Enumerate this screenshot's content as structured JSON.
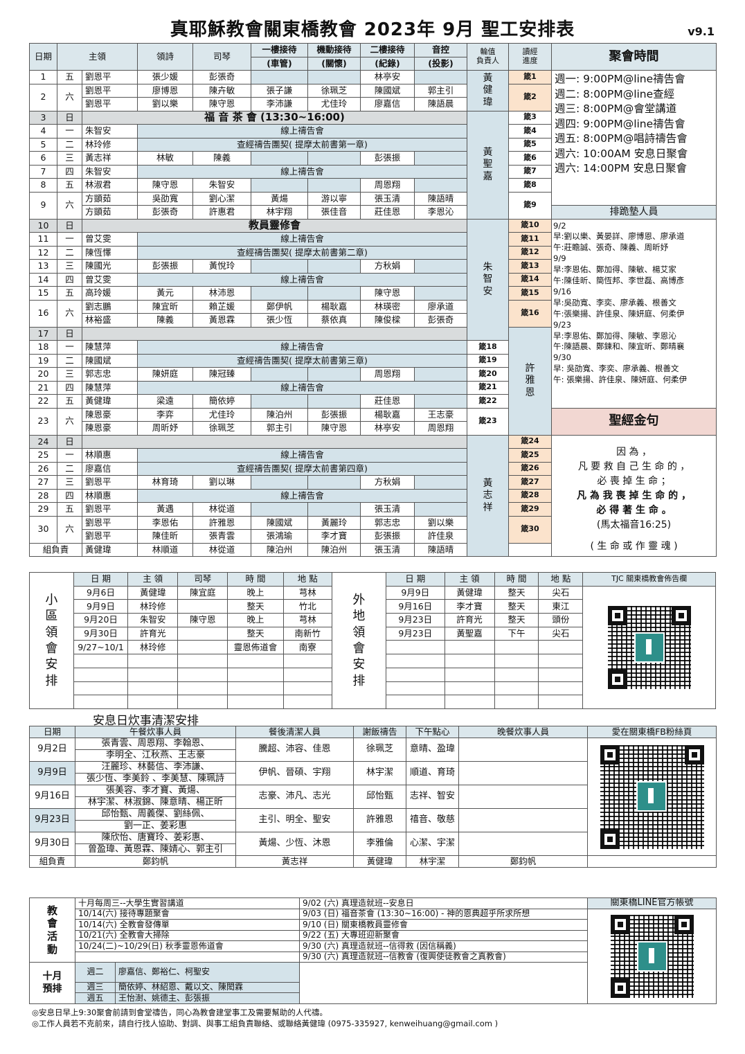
{
  "title": "真耶穌教會關東橋教會 2023年 9月 聖工安排表",
  "version": "v9.1",
  "schedule": {
    "headers": {
      "date": "日期",
      "leader": "主領",
      "hymn": "領詩",
      "piano": "司琴",
      "floor1_top": "一樓接待",
      "floor1_bottom": "(車管)",
      "mobile_top": "機動接待",
      "mobile_bottom": "(關懷)",
      "floor2_top": "二樓接待",
      "floor2_bottom": "(紀錄)",
      "sound_top": "音控",
      "sound_bottom": "(投影)",
      "duty_top": "輪值",
      "duty_bottom": "負責人",
      "reading_top": "讀經",
      "reading_bottom": "進度"
    },
    "rows": [
      [
        "1",
        "五",
        "劉恩平",
        "張少媛",
        "彭張奇",
        "",
        "",
        "林亭安",
        "",
        "箴1"
      ],
      [
        "2",
        "六",
        "劉恩平",
        "廖博恩",
        "陳卉敏",
        "張子謙",
        "徐珮芝",
        "陳國斌",
        "郭主引",
        "箴2"
      ],
      [
        "",
        "",
        "劉恩平",
        "劉以樂",
        "陳守恩",
        "李沛謙",
        "尤佳玲",
        "廖嘉信",
        "陳語晨",
        ""
      ],
      [
        "3",
        "日",
        "福 音 茶 會 (13:30~16:00)",
        "",
        "",
        "",
        "",
        "",
        "",
        "箴3"
      ],
      [
        "4",
        "一",
        "朱智安",
        "線上禱告會",
        "",
        "",
        "",
        "",
        "",
        "箴4"
      ],
      [
        "5",
        "二",
        "林玲修",
        "查經禱告團契( 提摩太前書第一章)",
        "",
        "",
        "",
        "",
        "",
        "箴5"
      ],
      [
        "6",
        "三",
        "黃志祥",
        "林敏",
        "陳義",
        "",
        "",
        "彭張振",
        "",
        "箴6"
      ],
      [
        "7",
        "四",
        "朱智安",
        "線上禱告會",
        "",
        "",
        "",
        "",
        "",
        "箴7"
      ],
      [
        "8",
        "五",
        "林淑君",
        "陳守恩",
        "朱智安",
        "",
        "",
        "周恩翔",
        "",
        "箴8"
      ],
      [
        "9",
        "六",
        "方顗茹",
        "吳劭寬",
        "劉心潔",
        "黃煬",
        "游以寧",
        "張玉清",
        "陳語晴",
        "箴9"
      ],
      [
        "",
        "",
        "方顗茹",
        "彭張奇",
        "許惠君",
        "林宇翔",
        "張佳音",
        "莊佳恩",
        "李恩沁",
        ""
      ],
      [
        "10",
        "日",
        "教員靈修會",
        "",
        "",
        "",
        "",
        "",
        "",
        "箴10"
      ],
      [
        "11",
        "一",
        "曾艾雯",
        "線上禱告會",
        "",
        "",
        "",
        "",
        "",
        "箴11"
      ],
      [
        "12",
        "二",
        "陳恆懌",
        "查經禱告團契( 提摩太前書第二章)",
        "",
        "",
        "",
        "",
        "",
        "箴12"
      ],
      [
        "13",
        "三",
        "陳國光",
        "彭張振",
        "黃悅玲",
        "",
        "",
        "方秋娟",
        "",
        "箴13"
      ],
      [
        "14",
        "四",
        "曾艾雯",
        "線上禱告會",
        "",
        "",
        "",
        "",
        "",
        "箴14"
      ],
      [
        "15",
        "五",
        "高玲媛",
        "黃元",
        "林沛恩",
        "",
        "",
        "陳守恩",
        "",
        "箴15"
      ],
      [
        "16",
        "六",
        "劉志鵬",
        "陳宜昕",
        "賴芷媛",
        "鄭伊帆",
        "楊耿嘉",
        "林瑛密",
        "廖承道",
        "箴16"
      ],
      [
        "",
        "",
        "林裕盛",
        "陳義",
        "黃恩霖",
        "張少恆",
        "蔡依真",
        "陳俊樑",
        "彭張奇",
        ""
      ],
      [
        "17",
        "日",
        "",
        "",
        "",
        "",
        "",
        "",
        "",
        "箴17"
      ],
      [
        "18",
        "一",
        "陳慧萍",
        "線上禱告會",
        "",
        "",
        "",
        "",
        "",
        "箴18"
      ],
      [
        "19",
        "二",
        "陳國斌",
        "查經禱告團契( 提摩太前書第三章)",
        "",
        "",
        "",
        "",
        "",
        "箴19"
      ],
      [
        "20",
        "三",
        "郭志忠",
        "陳妍庭",
        "陳冠臻",
        "",
        "",
        "周恩翔",
        "",
        "箴20"
      ],
      [
        "21",
        "四",
        "陳慧萍",
        "線上禱告會",
        "",
        "",
        "",
        "",
        "",
        "箴21"
      ],
      [
        "22",
        "五",
        "黃健瑋",
        "梁遠",
        "簡依婷",
        "",
        "",
        "莊佳恩",
        "",
        "箴22"
      ],
      [
        "23",
        "六",
        "陳恩豪",
        "李弈",
        "尤佳玲",
        "陳泊州",
        "彭張振",
        "楊耿嘉",
        "王志豪",
        "箴23"
      ],
      [
        "",
        "",
        "陳恩豪",
        "周昕妤",
        "徐珮芝",
        "郭主引",
        "陳守恩",
        "林亭安",
        "周恩翔",
        ""
      ],
      [
        "24",
        "日",
        "",
        "",
        "",
        "",
        "",
        "",
        "",
        "箴24"
      ],
      [
        "25",
        "一",
        "林順惠",
        "線上禱告會",
        "",
        "",
        "",
        "",
        "",
        "箴25"
      ],
      [
        "26",
        "二",
        "廖嘉信",
        "查經禱告團契( 提摩太前書第四章)",
        "",
        "",
        "",
        "",
        "",
        "箴26"
      ],
      [
        "27",
        "三",
        "劉恩平",
        "林育琦",
        "劉以琳",
        "",
        "",
        "方秋娟",
        "",
        "箴27"
      ],
      [
        "28",
        "四",
        "林順惠",
        "線上禱告會",
        "",
        "",
        "",
        "",
        "",
        "箴28"
      ],
      [
        "29",
        "五",
        "劉恩平",
        "黃遇",
        "林從道",
        "",
        "",
        "張玉清",
        "",
        "箴29"
      ],
      [
        "30",
        "六",
        "劉恩平",
        "李恩佑",
        "許雅恩",
        "陳國斌",
        "黃麗玲",
        "郭志忠",
        "劉以樂",
        "箴30"
      ],
      [
        "",
        "",
        "劉恩平",
        "陳佳昕",
        "張青雲",
        "張鴻瑜",
        "李才寶",
        "彭張振",
        "許佳泉",
        ""
      ]
    ],
    "group_row": [
      "組負責",
      "黃健瑋",
      "林順道",
      "林從道",
      "陳泊州",
      "陳泊州",
      "張玉清",
      "陳語晴",
      "黃健瑋"
    ],
    "duty": [
      "黃健瑋",
      "黃聖嘉",
      "朱智安",
      "許雅恩",
      "黃志祥"
    ]
  },
  "meeting": {
    "header": "聚會時間",
    "lines": [
      "週一: 9:00PM@line禱告會",
      "週二: 8:00PM@line查經",
      "週三: 8:00PM@會堂講道",
      "週四: 9:00PM@line禱告會",
      "週五: 8:00PM@唱詩禱告會",
      "週六: 10:00AM 安息日聚會",
      "週六: 14:00PM 安息日聚會"
    ]
  },
  "kneel": {
    "header": "排跪墊人員",
    "lines": [
      "9/2",
      "早:劉以樂、黃晏詳、廖博恩、廖承道",
      "午:莊瞻誠、張奇、陳義、周昕妤",
      "9/9",
      "早:李恩佑、鄭加得、陳敏、楊艾家",
      "午:陳佳昕、簡恆邦、李世磊、高博彥",
      "9/16",
      "早:吳劭寬、李奕、廖承義、根善文",
      "午:張樂揚、許佳泉、陳妍庭、何柔伊",
      "9/23",
      "早:李恩佑、鄭加得、陳敏、李恩沁",
      "午:陳語晨、鄭鍊和、陳宜昕、鄭晴襄",
      "9/30",
      "早: 吳劭寬、李奕、廖承義、根善文",
      "午: 張樂揚、許佳泉、陳妍庭、何柔伊"
    ]
  },
  "verse": {
    "header": "聖經金句",
    "l1": "因 為 ，",
    "l2": "凡 要 救 自 己 生 命 的 ，",
    "l3": "必 喪 掉 生 命 ；",
    "l4": "凡 為 我 喪 掉 生 命 的 ，",
    "l5": "必 得 著 生 命 。",
    "ref": "(馬太福音16:25)",
    "note": "( 生 命 或 作 靈 魂 )"
  },
  "small_group": {
    "side_label": "小區領會安排",
    "headers": [
      "日 期",
      "主 領",
      "司琴",
      "時 間",
      "地 點"
    ],
    "rows": [
      [
        "9月6日",
        "黃健瑋",
        "陳宜庭",
        "晚上",
        "芎林"
      ],
      [
        "9月9日",
        "林玲修",
        "",
        "整天",
        "竹北"
      ],
      [
        "9月20日",
        "朱智安",
        "陳守恩",
        "晚上",
        "芎林"
      ],
      [
        "9月30日",
        "許育光",
        "",
        "整天",
        "南新竹"
      ],
      [
        "9/27~10/1",
        "林玲修",
        "",
        "靈恩佈道會",
        "南寮"
      ]
    ]
  },
  "outside": {
    "side_label": "外地領會安排",
    "headers": [
      "日 期",
      "主 領",
      "時 間",
      "地 點"
    ],
    "rows": [
      [
        "9月9日",
        "黃健瑋",
        "整天",
        "尖石"
      ],
      [
        "9月16日",
        "李才寶",
        "整天",
        "東江"
      ],
      [
        "9月23日",
        "許育光",
        "整天",
        "頭份"
      ],
      [
        "9月23日",
        "黃聖嘉",
        "下午",
        "尖石"
      ]
    ]
  },
  "board_label": "TJC 關東橋教會佈告欄",
  "cook": {
    "title": "安息日炊事清潔安排",
    "headers": [
      "日期",
      "午餐炊事人員",
      "餐後清潔人員",
      "謝飯禱告",
      "下午點心",
      "晚餐炊事人員",
      "愛在關東橋FB粉絲頁"
    ],
    "rows": [
      [
        "9月2日",
        "張青雲、周恩翔、李翰恩、",
        "李明全、江秋燕、王志豪",
        "騰超、沛容、佳恩",
        "徐珮芝",
        "意晴、盈瑋"
      ],
      [
        "9月9日",
        "汪麗珍、林藝信、李沛謙、",
        "張少恆、李美鈴 、李美慧、陳珮詩",
        "伊帆、晉碩、宇翔",
        "林宇潔",
        "順道、育琦"
      ],
      [
        "9月16日",
        "張美容、李才寶、黃煬、",
        "林宇潔、林淑錦、陳意晴、楊正昕",
        "志豪、沛凡、志光",
        "邱怡甄",
        "志祥、智安"
      ],
      [
        "9月23日",
        "邱怡甄、周義傑、劉絲佩、",
        "劉一正、姜彩惠",
        "主引、明全、聖安",
        "許雅恩",
        "禧音、敬慈"
      ],
      [
        "9月30日",
        "陳欣怡、唐寶玲、姜彩惠、",
        "曾盈瑋、黃恩霖、陳婧心、郭主引",
        "黃煬、少恆、沐恩",
        "李雅倫",
        "心潔、宇潔"
      ]
    ],
    "group": [
      "組負責",
      "鄭鈞帆",
      "黃志祥",
      "黃健瑋",
      "林宇潔",
      "鄭鈞帆"
    ]
  },
  "activities": {
    "label": "教會活動",
    "left": [
      "十月每周三--大學生實習講道",
      "10/14(六) 接待專題聚會",
      "10/14(六) 全教會發傳單",
      "10/21(六) 全教會大掃除",
      "10/24(二)~10/29(日) 秋季靈恩佈道會"
    ],
    "right": [
      "9/02 (六) 真理造就班--安息日",
      "9/03 (日) 福音茶會 (13:30~16:00) - 神的恩典超乎所求所想",
      "9/10 (日) 關東橋教員靈修會",
      "9/22 (五) 大專班迎新聚會",
      "9/30 (六) 真理造就班--信得救 (因信稱義)",
      "9/30 (六) 真理造就班--信教會 (復興使徒教會之真教會)"
    ],
    "oct_label": "十月預排",
    "oct": [
      [
        "週二",
        "廖嘉信、鄭裕仁、柯聖安"
      ],
      [
        "週三",
        "簡依婷、林紹恩、戴以文、陳閎霖"
      ],
      [
        "週五",
        "王怡澍、姚德主、彭張振"
      ]
    ],
    "line_label": "關東橋LINE官方帳號"
  },
  "footer": {
    "n1": "◎安息日早上9:30聚會前請到會堂禱告，同心為教會建堂事工及需要幫助的人代禱。",
    "n2": "◎工作人員若不克前來，請自行找人協助、對調、與事工組負責聯絡、或聯絡黃健瑋 (0975-335927, kenweihuang@gmail.com )"
  },
  "colors": {
    "header_bg": "#dbe7ec",
    "gray_bg": "#d9dcdd",
    "blue_bg": "#d4e3ea",
    "peach_bg": "#fbe3cc",
    "verse_header_bg": "#f2d7d2"
  }
}
